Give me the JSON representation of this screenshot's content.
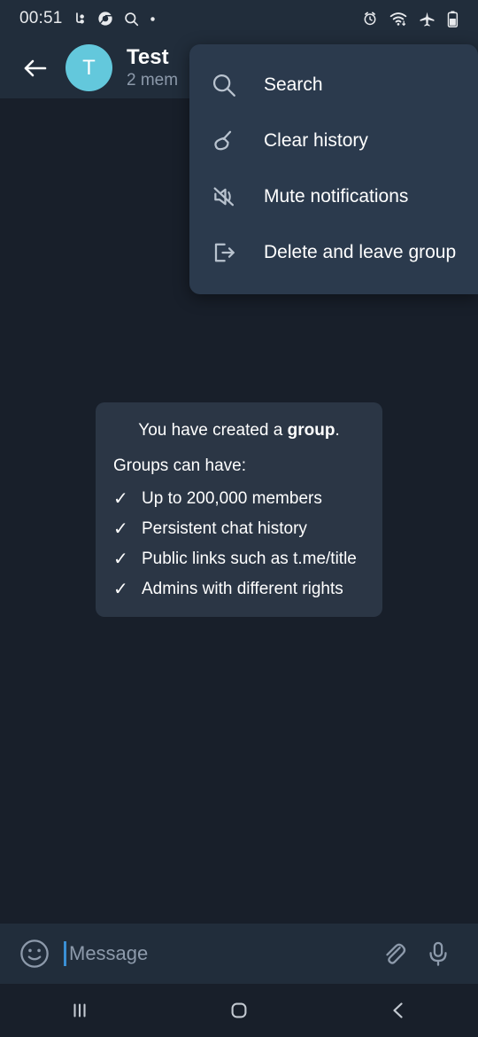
{
  "status_bar": {
    "clock": "00:51",
    "left_icons": [
      "notification-glyph-icon",
      "chrome-icon",
      "search-icon",
      "dot-icon"
    ],
    "right_icons": [
      "alarm-icon",
      "wifi-icon",
      "airplane-mode-icon",
      "battery-icon"
    ]
  },
  "header": {
    "back_label": "Back",
    "avatar_letter": "T",
    "avatar_color": "#63c8dc",
    "title": "Test",
    "subtitle": "2 mem"
  },
  "menu": {
    "items": [
      {
        "label": "Search",
        "icon": "search-icon"
      },
      {
        "label": "Clear history",
        "icon": "broom-icon"
      },
      {
        "label": "Mute notifications",
        "icon": "mute-icon"
      },
      {
        "label": "Delete and leave group",
        "icon": "exit-icon"
      }
    ]
  },
  "service_message": {
    "title_prefix": "You have created a ",
    "title_bold": "group",
    "title_suffix": ".",
    "subtitle": "Groups can have:",
    "check_glyph": "✓",
    "features": [
      "Up to 200,000 members",
      "Persistent chat history",
      "Public links such as t.me/title",
      "Admins with different rights"
    ]
  },
  "input_bar": {
    "placeholder": "Message",
    "emoji_icon": "smiley-icon",
    "attach_icon": "paperclip-icon",
    "voice_icon": "microphone-icon",
    "caret_color": "#3a8fd4"
  },
  "nav_bar": {
    "recents_label": "Recents",
    "home_label": "Home",
    "back_label": "Back"
  },
  "colors": {
    "chat_background": "#181f2a",
    "header_background": "#212d3b",
    "menu_background": "#2b3a4d",
    "bubble_background": "#2b3645",
    "accent": "#63c8dc"
  }
}
